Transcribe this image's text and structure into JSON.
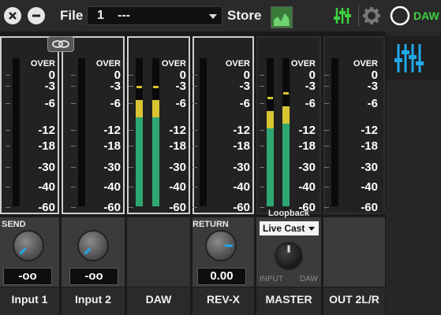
{
  "topbar": {
    "file_label": "File",
    "file_number": "1",
    "file_name": "---",
    "store_label": "Store",
    "daw_label": "DAW",
    "accent_green": "#3fd13f",
    "accent_blue": "#21a8e8"
  },
  "meter_scale": [
    "OVER",
    "0",
    "-3",
    "-6",
    "-12",
    "-18",
    "-30",
    "-40",
    "-60"
  ],
  "channels": [
    {
      "name": "Input 1",
      "send_label": "SEND",
      "send_value": "-oo",
      "meter": [
        0,
        0
      ]
    },
    {
      "name": "Input 2",
      "send_value": "-oo",
      "meter": [
        0,
        0.12
      ]
    },
    {
      "name": "DAW",
      "meter": [
        0.62,
        0.62
      ]
    },
    {
      "name": "REV-X",
      "return_label": "RETURN",
      "return_value": "0.00",
      "meter": [
        0,
        0
      ]
    },
    {
      "name": "MASTER",
      "loopback_label": "Loopback",
      "loopback_select": "Live Cast",
      "input_label": "INPUT",
      "daw_label": "DAW",
      "meter": [
        0.55,
        0.58
      ]
    },
    {
      "name": "OUT 2L/R",
      "meter": [
        0,
        0
      ]
    }
  ],
  "icons": {
    "close": "close-icon",
    "minimize": "minus-icon",
    "store": "store-chart-icon",
    "mixer": "mixer-faders-icon",
    "settings": "gear-icon",
    "power": "power-circle-icon",
    "link": "link-icon"
  }
}
